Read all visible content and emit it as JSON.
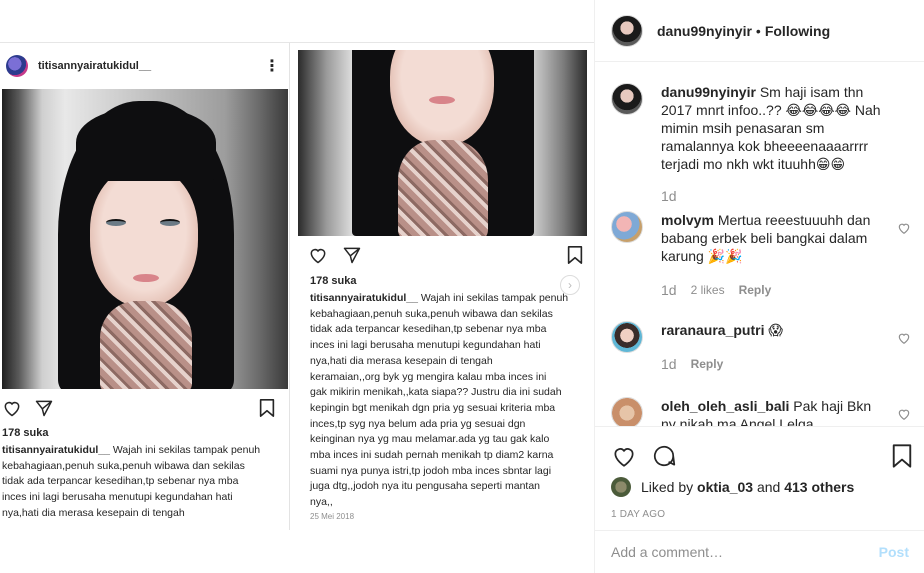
{
  "post_image": {
    "left_screenshot": {
      "username": "titisannyairatukidul__",
      "more_icon": "more-options-icon",
      "likes": "178 suka",
      "caption_user": "titisannyairatukidul__",
      "caption_lines": [
        "Wajah ini sekilas tampak penuh",
        "kebahagiaan,penuh suka,penuh wibawa dan sekilas",
        "tidak ada terpancar kesedihan,tp sebenar nya mba",
        "inces ini lagi berusaha menutupi kegundahan hati",
        "nya,hati dia merasa kesepain di tengah"
      ]
    },
    "right_screenshot": {
      "likes": "178 suka",
      "caption_user": "titisannyairatukidul__",
      "caption_lines": [
        "Wajah ini sekilas tampak penuh",
        "kebahagiaan,penuh suka,penuh wibawa dan sekilas",
        "tidak ada terpancar kesedihan,tp sebenar nya mba",
        "inces ini lagi berusaha menutupi kegundahan hati",
        "nya,hati dia merasa kesepain di tengah",
        "keramaian,,org byk yg mengira kalau mba inces ini",
        "gak mikirin menikah,,kata siapa?? Justru dia ini sudah",
        "kepingin bgt menikah dgn pria yg sesuai kriteria mba",
        "inces,tp syg nya belum ada pria yg sesuai dgn",
        "keinginan nya yg mau melamar.ada yg tau gak kalo",
        "mba inces ini sudah pernah menikah tp diam2 karna",
        "suami nya punya istri,tp jodoh mba inces sbntar lagi",
        "juga dtg,,jodoh nya itu pengusaha seperti mantan",
        "nya,,"
      ],
      "date": "25 Mei 2018"
    }
  },
  "header": {
    "username": "danu99nyinyir",
    "separator": "•",
    "follow_status": "Following"
  },
  "comments": [
    {
      "username": "danu99nyinyir",
      "text": "Sm haji isam thn 2017 mnrt infoo..?? 😂😂😂😂 Nah mimin msih penasaran sm ramalannya kok bheeeenaaaarrrr terjadi mo nkh wkt ituuhh😁😁",
      "time": "1d",
      "likes": "",
      "reply": ""
    },
    {
      "username": "molvym",
      "text": "Mertua reeestuuuhh dan babang erbek beli bangkai dalam karung 🎉🎉",
      "time": "1d",
      "likes": "2 likes",
      "reply": "Reply"
    },
    {
      "username": "raranaura_putri",
      "text": "😱",
      "time": "1d",
      "likes": "",
      "reply": "Reply"
    },
    {
      "username": "oleh_oleh_asli_bali",
      "text": "Pak haji Bkn ny nikah ma Angel Lelga",
      "time": "",
      "likes": "",
      "reply": ""
    }
  ],
  "actions": {
    "like_icon": "heart-icon",
    "comment_icon": "comment-bubble-icon",
    "save_icon": "bookmark-icon",
    "liked_by_prefix": "Liked by",
    "liked_by_user": "oktia_03",
    "liked_by_and": "and",
    "liked_by_others": "413 others",
    "time_ago": "1 DAY AGO"
  },
  "comment_box": {
    "placeholder": "Add a comment…",
    "post_label": "Post"
  },
  "colors": {
    "text": "#262626",
    "muted": "#8e8e8e",
    "divider": "#efefef",
    "post_disabled": "#b2dffc"
  }
}
